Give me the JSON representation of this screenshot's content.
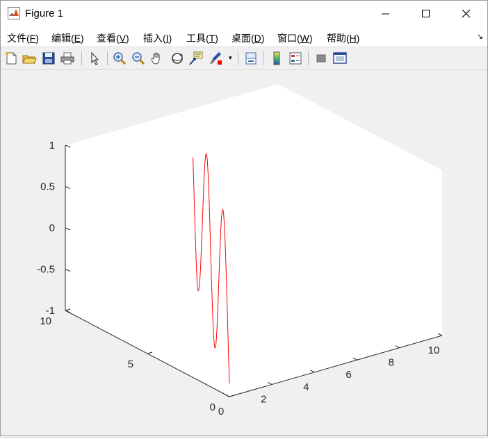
{
  "window": {
    "title": "Figure 1",
    "controls": {
      "minimize": "minimize",
      "maximize": "maximize",
      "close": "close"
    }
  },
  "menu": [
    {
      "label": "文件(",
      "key": "F",
      "suffix": ")"
    },
    {
      "label": "编辑(",
      "key": "E",
      "suffix": ")"
    },
    {
      "label": "查看(",
      "key": "V",
      "suffix": ")"
    },
    {
      "label": "插入(",
      "key": "I",
      "suffix": ")"
    },
    {
      "label": "工具(",
      "key": "T",
      "suffix": ")"
    },
    {
      "label": "桌面(",
      "key": "D",
      "suffix": ")"
    },
    {
      "label": "窗口(",
      "key": "W",
      "suffix": ")"
    },
    {
      "label": "帮助(",
      "key": "H",
      "suffix": ")"
    }
  ],
  "toolbar_icons": [
    "new-figure-icon",
    "open-file-icon",
    "save-icon",
    "print-icon",
    "select-arrow-icon",
    "zoom-in-icon",
    "zoom-out-icon",
    "pan-hand-icon",
    "rotate-3d-icon",
    "data-cursor-icon",
    "brush-icon",
    "link-plot-icon",
    "colorbar-icon",
    "legend-icon",
    "hide-plot-tools-icon",
    "show-plot-tools-icon"
  ],
  "colors": {
    "line": "#ff0000",
    "axes_bg": "#ffffff",
    "figure_bg": "#f0f0f0",
    "axis": "#262626"
  },
  "chart_data": {
    "type": "line",
    "view": "3d",
    "title": "",
    "xlabel": "",
    "ylabel": "",
    "zlabel": "",
    "xlim": [
      0,
      10
    ],
    "ylim": [
      0,
      10
    ],
    "zlim": [
      -1,
      1
    ],
    "xticks": [
      0,
      2,
      4,
      6,
      8,
      10
    ],
    "yticks": [
      0,
      5,
      10
    ],
    "zticks": [
      -1,
      -0.5,
      0,
      0.5,
      1
    ],
    "xtick_labels": [
      "0",
      "2",
      "4",
      "6",
      "8",
      "10"
    ],
    "ytick_labels": [
      "0",
      "5",
      "10"
    ],
    "ztick_labels": [
      "-1",
      "-0.5",
      "0",
      "0.5",
      "1"
    ],
    "grid": false,
    "series": [
      {
        "color": "#ff0000",
        "x": [
          0.0,
          0.25,
          0.5,
          0.75,
          1.0,
          1.25,
          1.5,
          1.75,
          2.0,
          2.25,
          2.5,
          2.75,
          3.0,
          3.25,
          3.5,
          3.75,
          4.0,
          4.25,
          4.5,
          4.75,
          5.0,
          5.25,
          5.5,
          5.75,
          6.0
        ],
        "y": [
          0.0,
          0.417,
          0.833,
          1.25,
          1.667,
          2.083,
          2.5,
          2.917,
          3.333,
          3.75,
          4.167,
          4.583,
          5.0,
          5.417,
          5.833,
          6.25,
          6.667,
          7.083,
          7.5,
          7.917,
          8.333,
          8.75,
          9.167,
          9.583,
          10.0
        ],
        "z": [
          -0.84,
          -0.28,
          0.31,
          0.77,
          0.99,
          0.9,
          0.52,
          -0.05,
          -0.6,
          -0.94,
          -0.98,
          -0.71,
          -0.21,
          0.37,
          0.82,
          1.0,
          0.87,
          0.46,
          -0.11,
          -0.62,
          -0.93,
          -0.97,
          -0.67,
          -0.16,
          0.41
        ]
      }
    ]
  }
}
